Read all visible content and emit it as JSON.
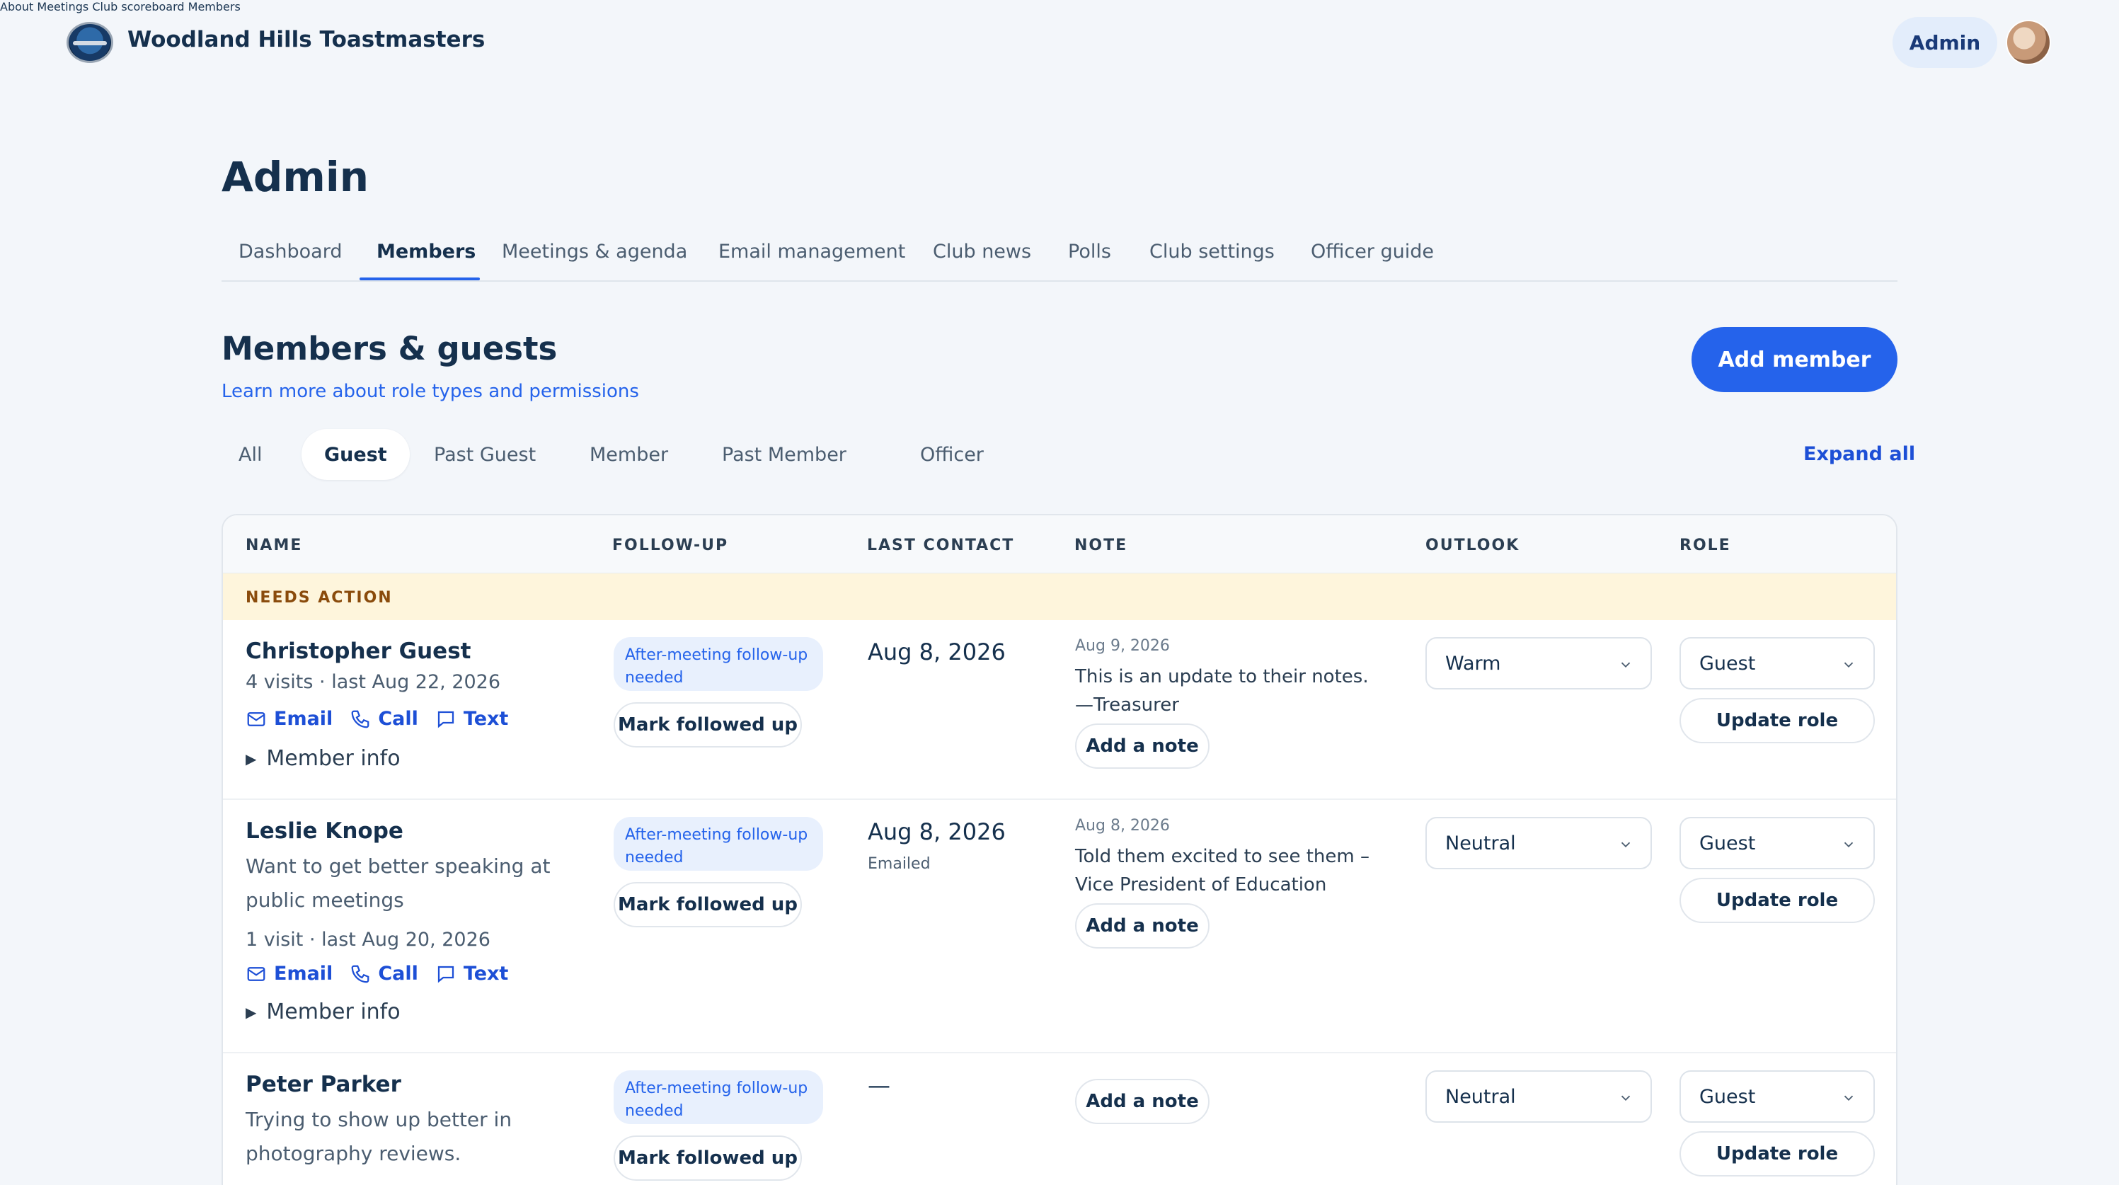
{
  "header": {
    "brand": "Woodland Hills Toastmasters",
    "nav": [
      "About",
      "Meetings",
      "Club scoreboard",
      "Members",
      "Admin"
    ]
  },
  "page": {
    "title": "Admin",
    "tabs": [
      "Dashboard",
      "Members",
      "Meetings & agenda",
      "Email management",
      "Club news",
      "Polls",
      "Club settings",
      "Officer guide"
    ],
    "active_tab": "Members"
  },
  "section": {
    "title": "Members & guests",
    "learn_link": "Learn more about role types and permissions",
    "add_button": "Add member",
    "filters": [
      "All",
      "Guest",
      "Past Guest",
      "Member",
      "Past Member",
      "Officer"
    ],
    "active_filter": "Guest",
    "expand_all": "Expand all"
  },
  "table": {
    "columns": [
      "NAME",
      "FOLLOW-UP",
      "LAST CONTACT",
      "NOTE",
      "OUTLOOK",
      "ROLE"
    ],
    "group_label": "NEEDS ACTION",
    "actions": {
      "email": "Email",
      "call": "Call",
      "text": "Text",
      "member_info": "Member info",
      "mark_followed": "Mark followed up",
      "add_note": "Add a note",
      "update_role": "Update role"
    },
    "rows": [
      {
        "name": "Christopher Guest",
        "visits": "4 visits · last Aug 22, 2026",
        "followup": "After-meeting follow-up needed",
        "last_contact": "Aug 8, 2026",
        "note_date": "Aug 9, 2026",
        "note": "This is an update to their notes. —Treasurer",
        "outlook": "Warm",
        "role": "Guest"
      },
      {
        "name": "Leslie Knope",
        "goal": "Want to get better speaking at public meetings",
        "visits": "1 visit · last Aug 20, 2026",
        "followup": "After-meeting follow-up needed",
        "last_contact": "Aug 8, 2026",
        "last_contact_method": "Emailed",
        "note_date": "Aug 8, 2026",
        "note": "Told them excited to see them – Vice President of Education",
        "outlook": "Neutral",
        "role": "Guest"
      },
      {
        "name": "Peter Parker",
        "goal": "Trying to show up better in photography reviews.",
        "followup": "After-meeting follow-up needed",
        "last_contact": "—",
        "outlook": "Neutral",
        "role": "Guest"
      }
    ]
  }
}
